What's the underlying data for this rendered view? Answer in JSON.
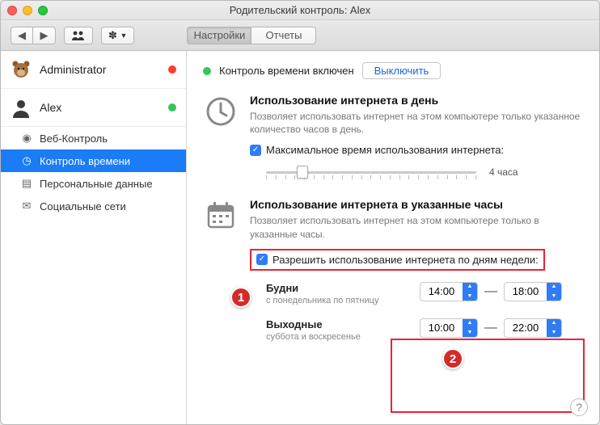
{
  "window_title": "Родительский контроль: Alex",
  "tabs": {
    "settings": "Настройки",
    "reports": "Отчеты"
  },
  "users": [
    {
      "name": "Administrator",
      "status": "red"
    },
    {
      "name": "Alex",
      "status": "grn"
    }
  ],
  "sidebar_items": [
    {
      "label": "Веб-Контроль"
    },
    {
      "label": "Контроль времени"
    },
    {
      "label": "Персональные данные"
    },
    {
      "label": "Социальные сети"
    }
  ],
  "status": {
    "text": "Контроль времени включен",
    "button": "Выключить"
  },
  "section_daily": {
    "title": "Использование интернета в день",
    "desc": "Позволяет использовать интернет на этом компьютере только указанное количество часов в день.",
    "checkbox": "Максимальное время использования интернета:",
    "slider_label": "4 часа"
  },
  "section_hours": {
    "title": "Использование интернета в указанные часы",
    "desc": "Позволяет использовать интернет на этом компьютере только в указанные часы.",
    "checkbox": "Разрешить использование интернета по дням недели:",
    "weekdays": {
      "title": "Будни",
      "sub": "с понедельника по пятницу",
      "from": "14:00",
      "to": "18:00"
    },
    "weekend": {
      "title": "Выходные",
      "sub": "суббота и воскресенье",
      "from": "10:00",
      "to": "22:00"
    }
  },
  "annotations": {
    "badge1": "1",
    "badge2": "2"
  },
  "help": "?"
}
